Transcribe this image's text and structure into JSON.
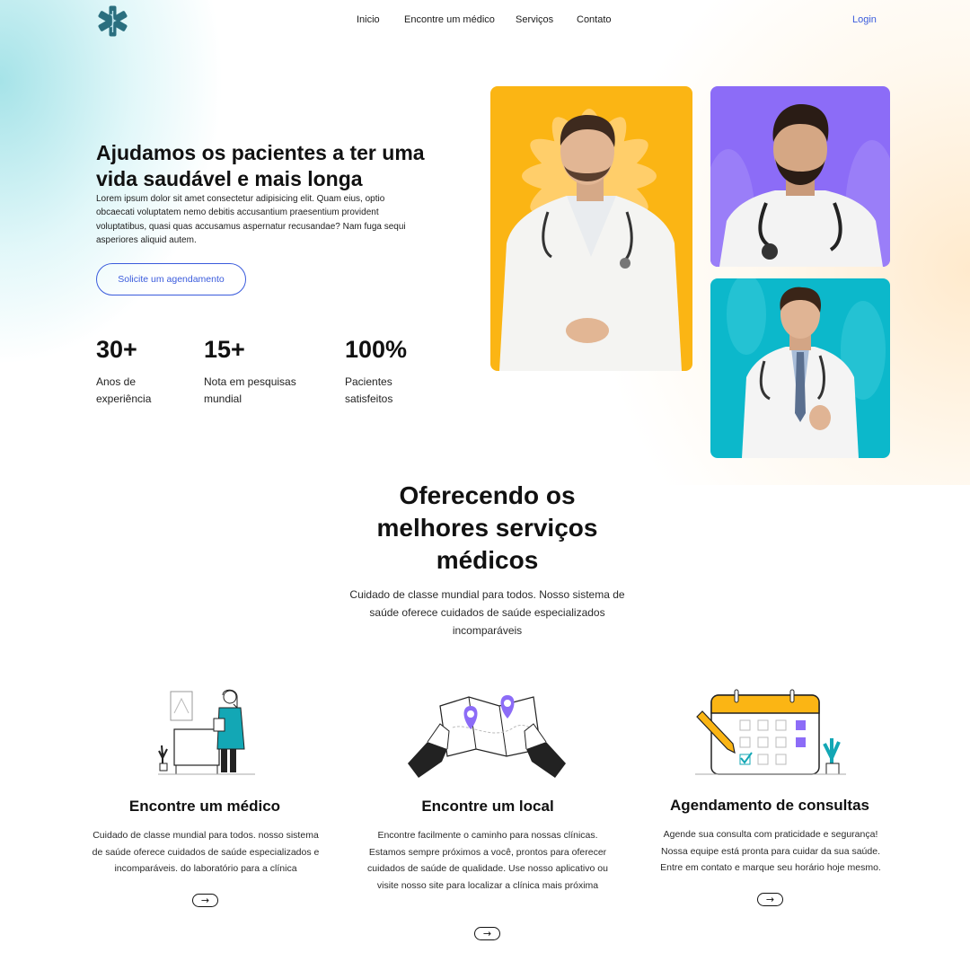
{
  "nav": {
    "links": [
      "Inicio",
      "Encontre um médico",
      "Serviços",
      "Contato"
    ],
    "login": "Login",
    "logo_icon": "medical-star-of-life-icon"
  },
  "hero": {
    "title": "Ajudamos os pacientes a ter uma vida saudável e mais longa",
    "text": "Lorem ipsum dolor sit amet consectetur adipisicing elit. Quam eius, optio obcaecati voluptatem nemo debitis accusantium praesentium provident voluptatibus, quasi quas accusamus aspernatur recusandae? Nam fuga sequi asperiores aliquid autem.",
    "cta": "Solicite um agendamento",
    "stats": [
      {
        "value": "30+",
        "label": "Anos de experiência"
      },
      {
        "value": "15+",
        "label": "Nota em pesquisas mundial"
      },
      {
        "value": "100%",
        "label": "Pacientes satisfeitos"
      }
    ]
  },
  "photos": [
    {
      "bg": "#fbb514",
      "subject": "doctor-portrait"
    },
    {
      "bg": "#8c6cf7",
      "subject": "doctor-portrait"
    },
    {
      "bg": "#0cb8cb",
      "subject": "doctor-portrait"
    }
  ],
  "services": {
    "title": "Oferecendo os melhores serviços médicos",
    "subtitle": "Cuidado de classe mundial para todos. Nosso sistema de saúde oferece cuidados de saúde especializados incomparáveis",
    "items": [
      {
        "title": "Encontre um médico",
        "desc": "Cuidado de classe mundial para todos. nosso sistema de saúde oferece cuidados de saúde especializados e incomparáveis. do laboratório para a clínica",
        "icon": "doctor-illustration"
      },
      {
        "title": "Encontre um local",
        "desc": "Encontre facilmente o caminho para nossas clínicas. Estamos sempre próximos a você, prontos para oferecer cuidados de saúde de qualidade. Use nosso aplicativo ou visite nosso site para localizar a clínica mais próxima",
        "icon": "map-illustration"
      },
      {
        "title": "Agendamento de consultas",
        "desc": "Agende sua consulta com praticidade e segurança! Nossa equipe está pronta para cuidar da sua saúde. Entre em contato e marque seu horário hoje mesmo.",
        "icon": "calendar-illustration"
      }
    ],
    "arrow": "→"
  },
  "colors": {
    "accent": "#3a5bdc",
    "logo": "#2a6f7f",
    "purple": "#8c6cf7",
    "yellow": "#fbb514",
    "teal": "#0cb8cb"
  }
}
